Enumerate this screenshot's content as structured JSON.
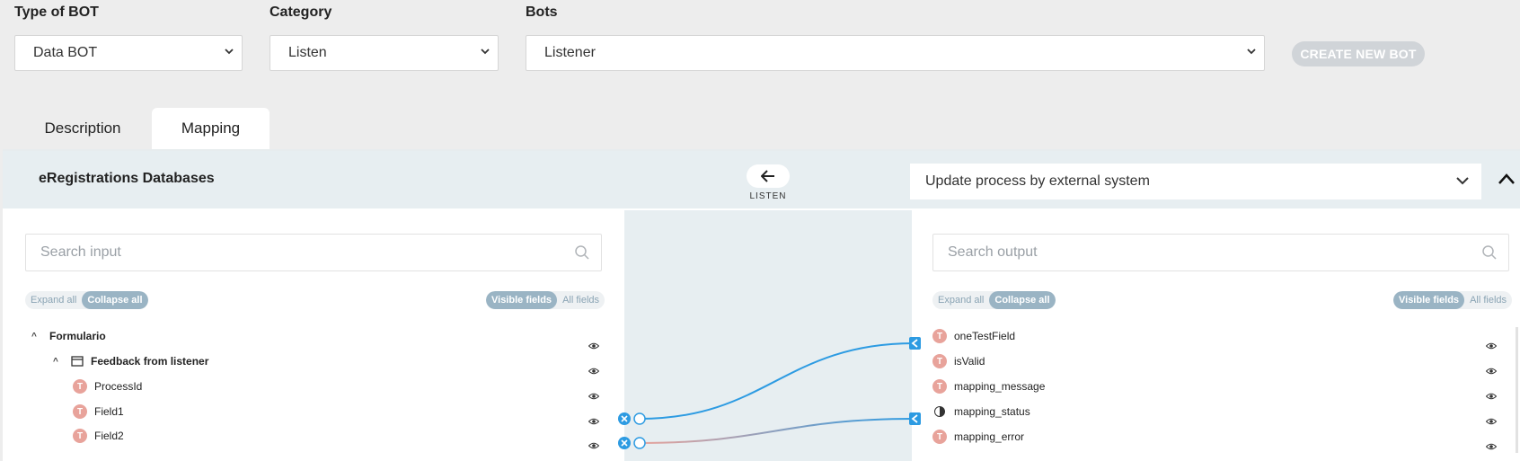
{
  "top": {
    "type_label": "Type of BOT",
    "type_value": "Data BOT",
    "category_label": "Category",
    "category_value": "Listen",
    "bots_label": "Bots",
    "bots_value": "Listener",
    "create_button": "CREATE NEW BOT"
  },
  "tabs": [
    {
      "label": "Description",
      "active": false
    },
    {
      "label": "Mapping",
      "active": true
    }
  ],
  "mapping": {
    "source_title": "eRegistrations Databases",
    "direction_label": "LISTEN",
    "target_value": "Update process by external system",
    "input": {
      "search_placeholder": "Search input",
      "expand_all": "Expand all",
      "collapse_all": "Collapse all",
      "visible_fields": "Visible fields",
      "all_fields": "All fields",
      "rows": [
        {
          "label": "Formulario"
        },
        {
          "label": "Feedback from listener"
        },
        {
          "label": "ProcessId",
          "icon": "T"
        },
        {
          "label": "Field1",
          "icon": "T"
        },
        {
          "label": "Field2",
          "icon": "T"
        }
      ]
    },
    "output": {
      "search_placeholder": "Search output",
      "expand_all": "Expand all",
      "collapse_all": "Collapse all",
      "visible_fields": "Visible fields",
      "all_fields": "All fields",
      "rows": [
        {
          "label": "oneTestField",
          "icon": "T"
        },
        {
          "label": "isValid",
          "icon": "T"
        },
        {
          "label": "mapping_message",
          "icon": "T"
        },
        {
          "label": "mapping_status",
          "icon": "half"
        },
        {
          "label": "mapping_error",
          "icon": "T"
        }
      ]
    }
  },
  "colors": {
    "accent": "#2d9be2",
    "connector_alt": "#e8a39b",
    "pill_active": "#9ab4c4",
    "field_icon": "#e8a39b"
  }
}
